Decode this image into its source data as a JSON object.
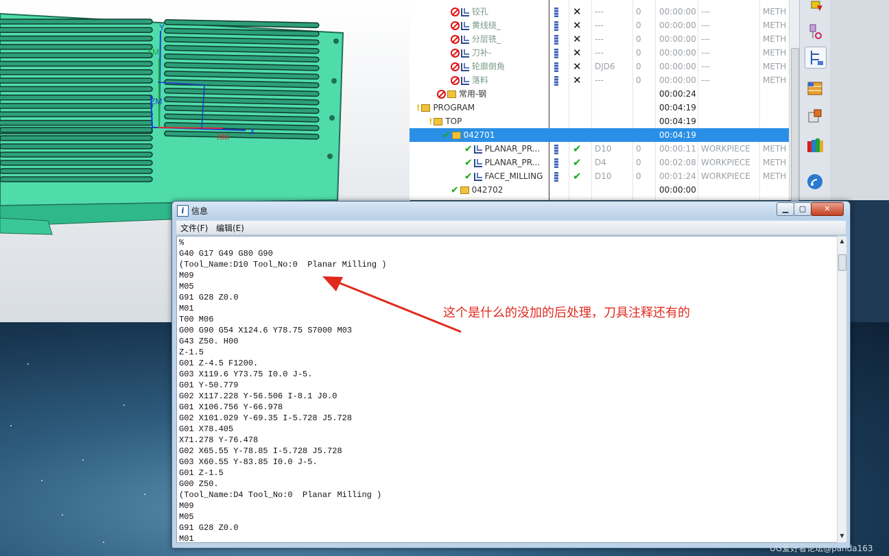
{
  "navigator": {
    "rows": [
      {
        "name": "铰孔",
        "tool": "---",
        "x": "0",
        "time": "00:00:00",
        "geom": "---",
        "meth": "METH",
        "status": "x"
      },
      {
        "name": "黄线绕_",
        "tool": "---",
        "x": "0",
        "time": "00:00:00",
        "geom": "---",
        "meth": "METH",
        "status": "x"
      },
      {
        "name": "分层铣_",
        "tool": "---",
        "x": "0",
        "time": "00:00:00",
        "geom": "---",
        "meth": "METH",
        "status": "x"
      },
      {
        "name": "刀补-",
        "tool": "---",
        "x": "0",
        "time": "00:00:00",
        "geom": "---",
        "meth": "METH",
        "status": "x"
      },
      {
        "name": "轮廓倒角",
        "tool": "DJD6",
        "x": "0",
        "time": "00:00:00",
        "geom": "---",
        "meth": "METH",
        "status": "x"
      },
      {
        "name": "落料",
        "tool": "---",
        "x": "0",
        "time": "00:00:00",
        "geom": "---",
        "meth": "METH",
        "status": "x"
      },
      {
        "name": "常用-钢",
        "tool": "",
        "x": "",
        "time": "00:00:24",
        "geom": "",
        "meth": "",
        "status": ""
      },
      {
        "name": "PROGRAM",
        "tool": "",
        "x": "",
        "time": "00:04:19",
        "geom": "",
        "meth": "",
        "status": ""
      },
      {
        "name": "TOP",
        "tool": "",
        "x": "",
        "time": "00:04:19",
        "geom": "",
        "meth": "",
        "status": ""
      },
      {
        "name": "042701",
        "tool": "",
        "x": "",
        "time": "00:04:19",
        "geom": "",
        "meth": "",
        "status": ""
      },
      {
        "name": "PLANAR_PR...",
        "tool": "D10",
        "x": "0",
        "time": "00:00:11",
        "geom": "WORKPIECE",
        "meth": "METH",
        "status": "ok"
      },
      {
        "name": "PLANAR_PR...",
        "tool": "D4",
        "x": "0",
        "time": "00:02:08",
        "geom": "WORKPIECE",
        "meth": "METH",
        "status": "ok"
      },
      {
        "name": "FACE_MILLING",
        "tool": "D10",
        "x": "0",
        "time": "00:01:24",
        "geom": "WORKPIECE",
        "meth": "METH",
        "status": "ok"
      },
      {
        "name": "042702",
        "tool": "",
        "x": "",
        "time": "00:00:00",
        "geom": "",
        "meth": "",
        "status": ""
      }
    ]
  },
  "graphics": {
    "axis_labels": [
      "X",
      "XM",
      "Y",
      "YM",
      "ZM"
    ]
  },
  "info_window": {
    "title": "信息",
    "menu": [
      "文件(F)",
      "编辑(E)"
    ],
    "code_lines": [
      "%",
      "G40 G17 G49 G80 G90",
      "(Tool_Name:D10 Tool_No:0  Planar Milling )",
      "M09",
      "M05",
      "G91 G28 Z0.0",
      "M01",
      "T00 M06",
      "G00 G90 G54 X124.6 Y78.75 S7000 M03",
      "G43 Z50. H00",
      "Z-1.5",
      "G01 Z-4.5 F1200.",
      "G03 X119.6 Y73.75 I0.0 J-5.",
      "G01 Y-50.779",
      "G02 X117.228 Y-56.506 I-8.1 J0.0",
      "G01 X106.756 Y-66.978",
      "G02 X101.029 Y-69.35 I-5.728 J5.728",
      "G01 X78.405",
      "X71.278 Y-76.478",
      "G02 X65.55 Y-78.85 I-5.728 J5.728",
      "G03 X60.55 Y-83.85 I0.0 J-5.",
      "G01 Z-1.5",
      "G00 Z50.",
      "(Tool_Name:D4 Tool_No:0  Planar Milling )",
      "M09",
      "M05",
      "G91 G28 Z0.0",
      "M01"
    ]
  },
  "annotation": {
    "text": "这个是什么的没加的后处理，刀具注释还有的",
    "color": "#e02a1e"
  },
  "watermark": "UG爱好者论坛@panda163",
  "colors": {
    "model": "#4fdcaa",
    "selection": "#2a8fe6"
  }
}
